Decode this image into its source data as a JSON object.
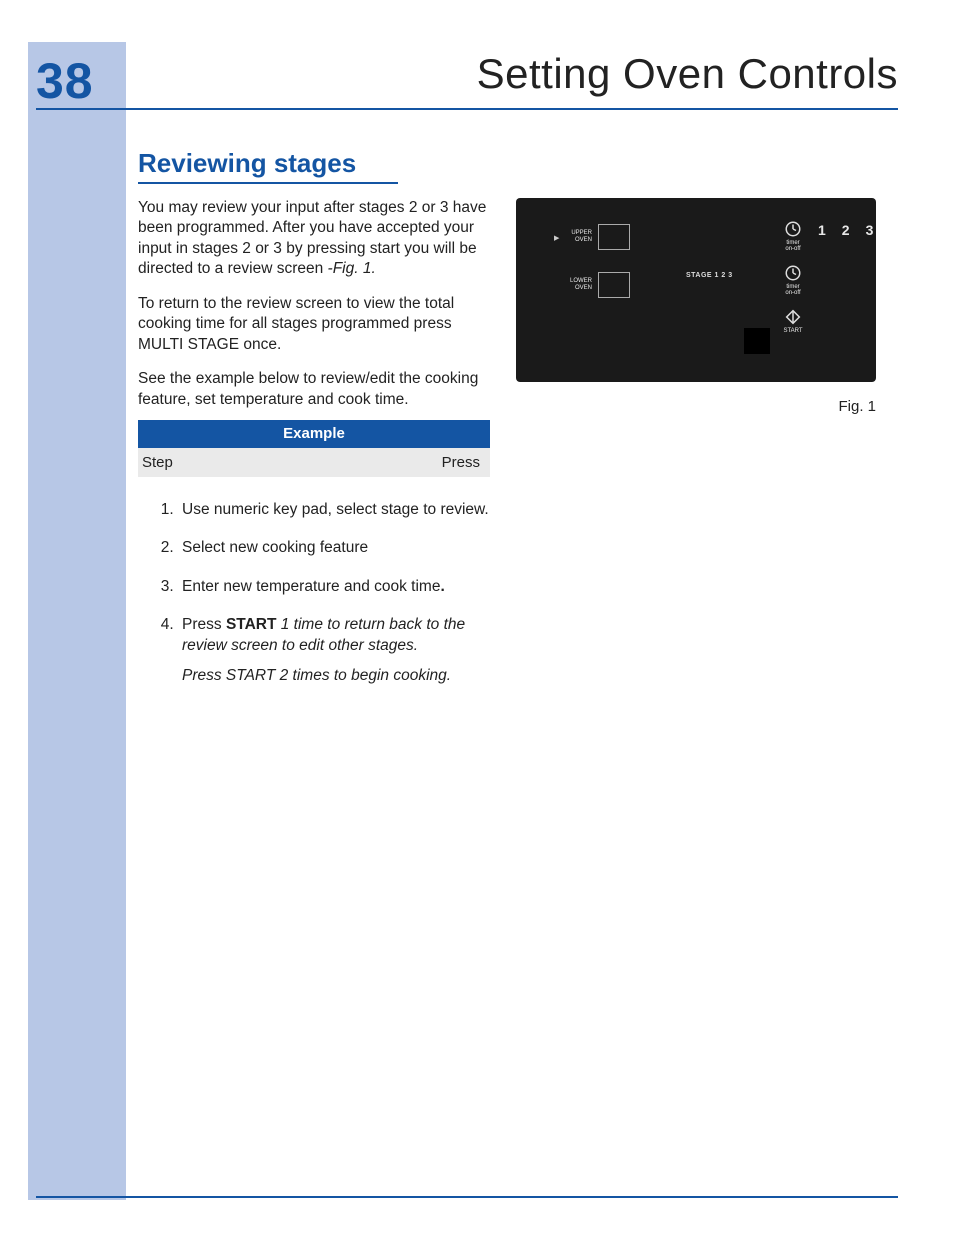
{
  "page_number": "38",
  "doc_title": "Setting Oven Controls",
  "section_title": "Reviewing stages",
  "paragraphs": {
    "p1a": "You may review your input after stages 2 or 3 have been programmed. After you have accepted your input in stages 2 or 3 by pressing start you will be directed to a review screen ",
    "p1b_figref": "-Fig. 1.",
    "p2": "To return to the review screen to view the total cooking time for all stages programmed press MULTI STAGE once.",
    "p3": "See the example below to review/edit the cooking feature, set temperature and cook time."
  },
  "example": {
    "header": "Example",
    "col_left": "Step",
    "col_right": "Press"
  },
  "steps": {
    "s1": "Use numeric key pad, select stage to review.",
    "s2": "Select new cooking feature",
    "s3": "Enter new temperature and cook time",
    "s3_dot": ".",
    "s4_a": "Press ",
    "s4_b_bold": "START",
    "s4_c_italic": " 1 time to return back to the review screen to edit other stages.",
    "s4_d_italic": "Press START 2 times to begin cooking."
  },
  "figure": {
    "caption": "Fig. 1",
    "upper_label": "UPPER\nOVEN",
    "lower_label": "LOWER\nOVEN",
    "stage_text": "STAGE 1 2 3",
    "timer_label": "timer\non-off",
    "start_label": "START",
    "digit1": "1",
    "digit2": "2",
    "digit3": "3"
  }
}
